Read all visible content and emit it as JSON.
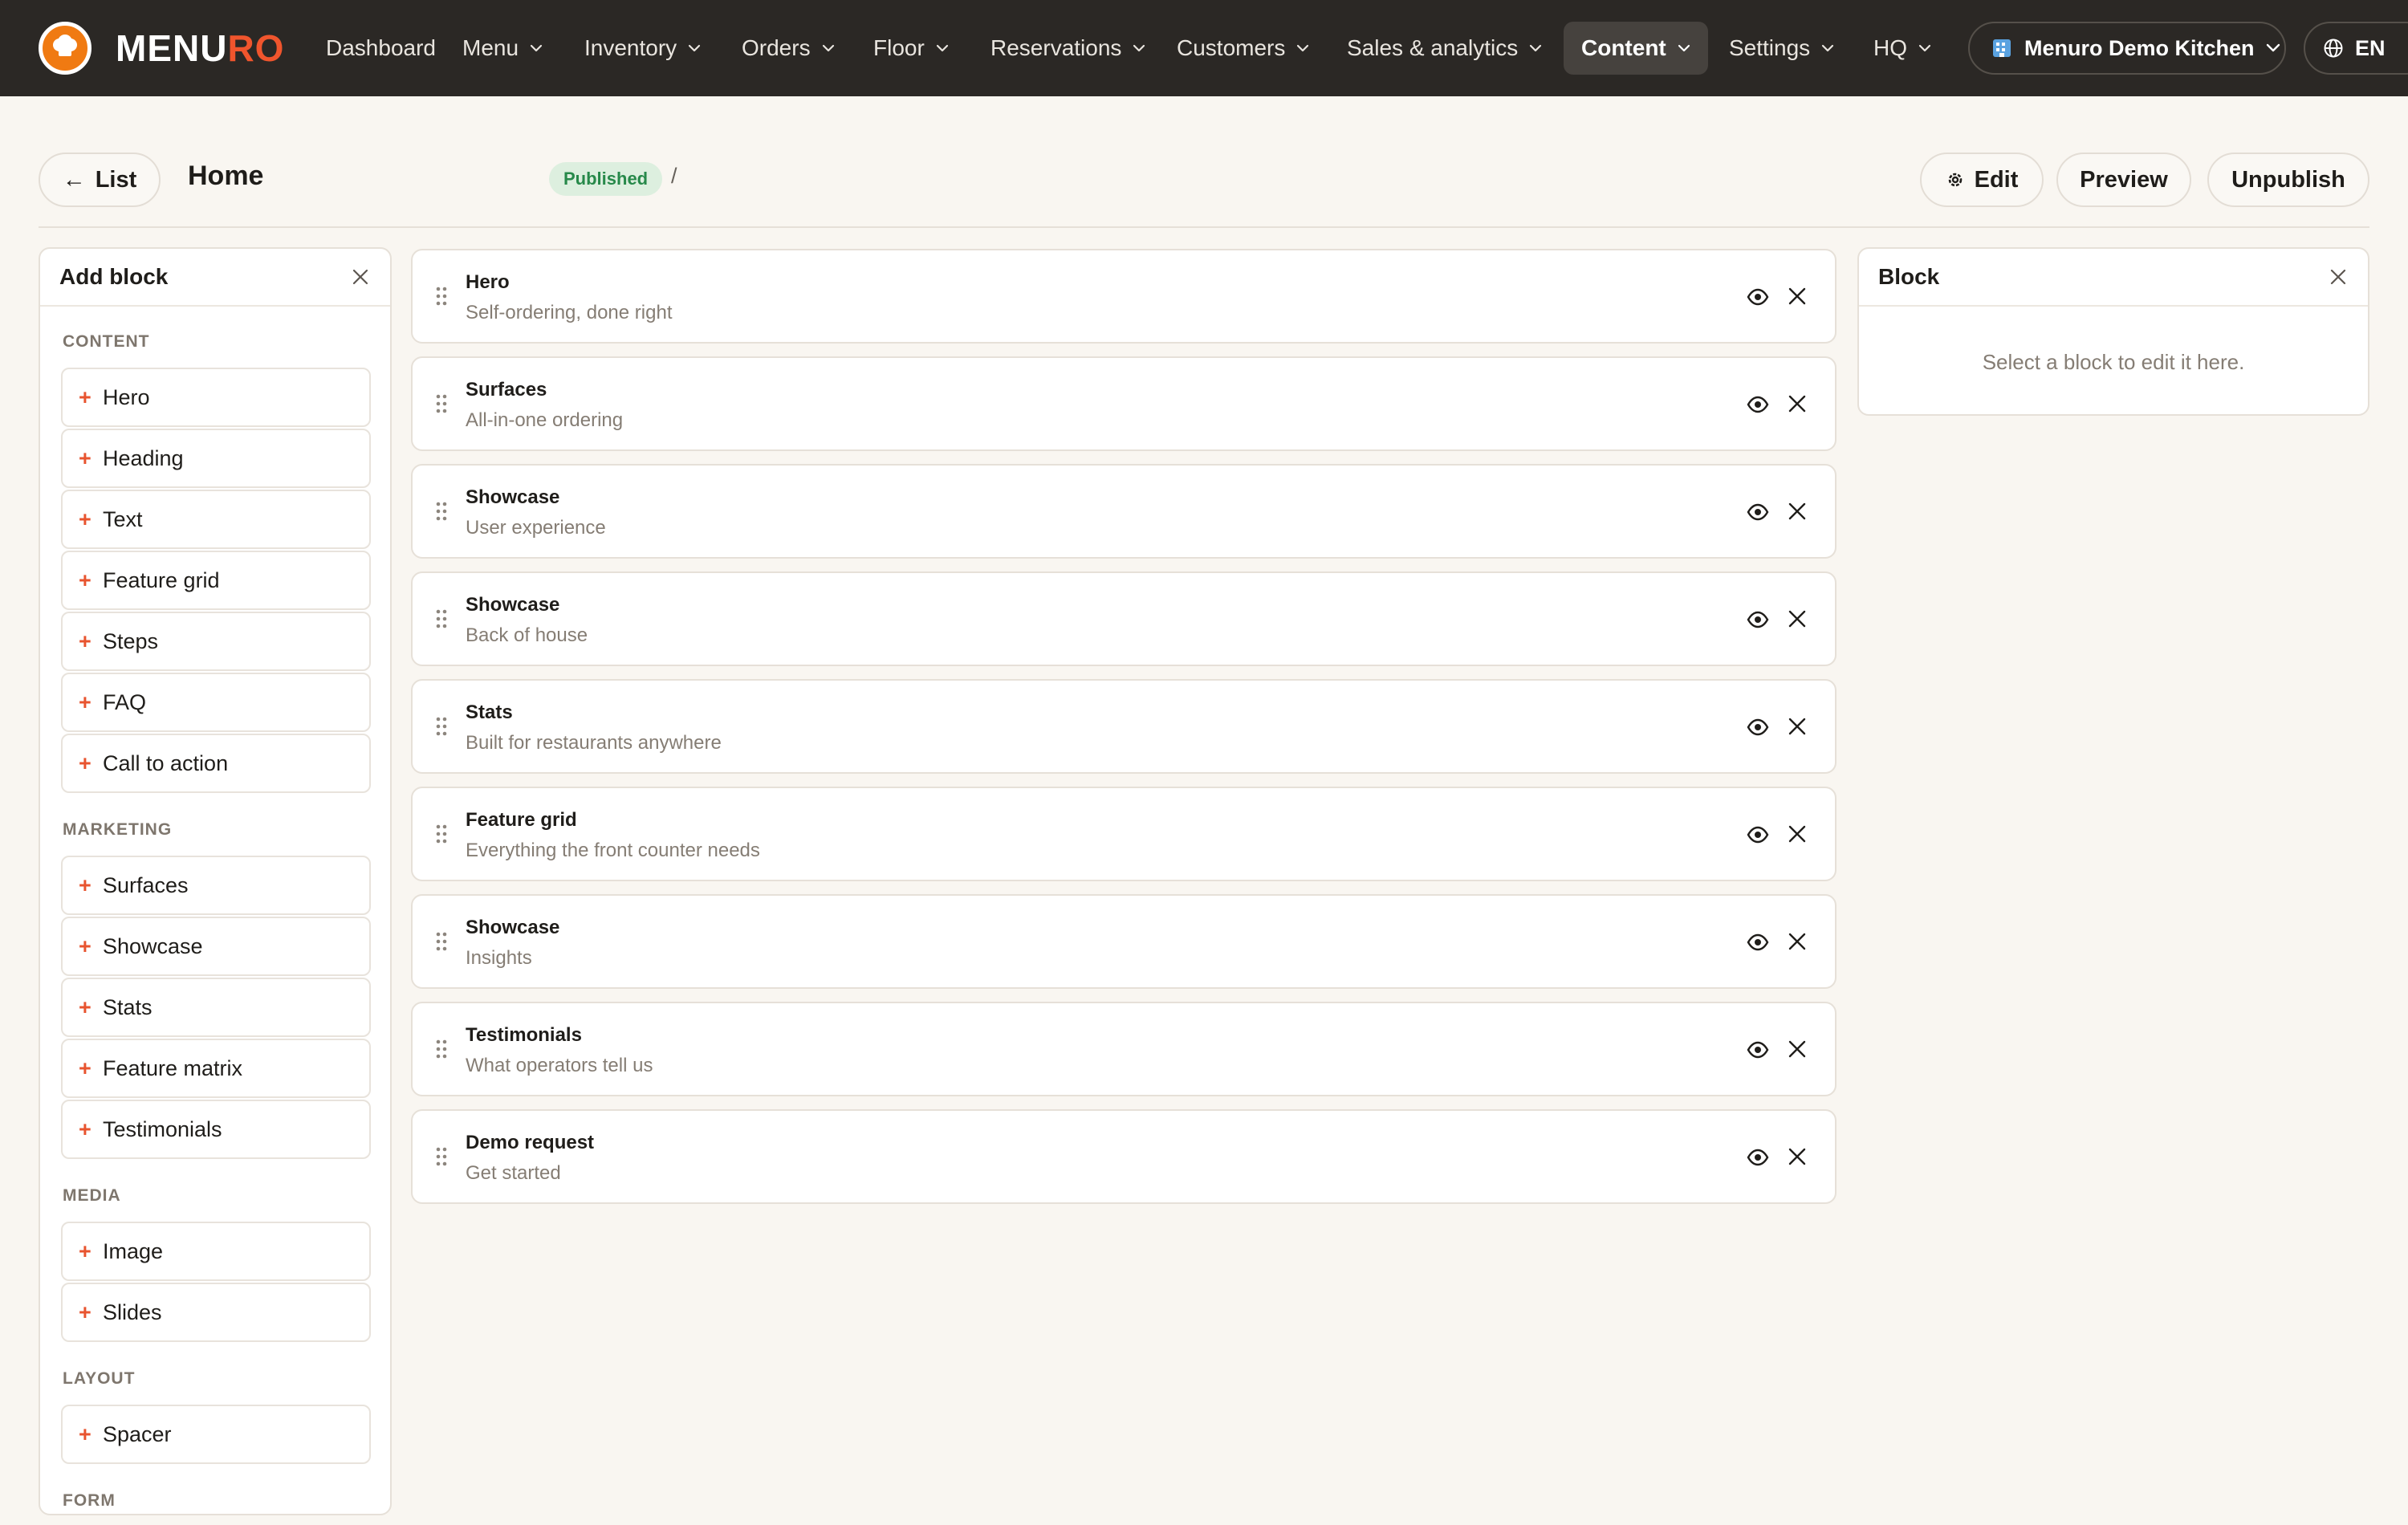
{
  "brand": {
    "name_part1": "MENU",
    "name_part2": "RO"
  },
  "nav": [
    {
      "label": "Dashboard",
      "has_menu": false
    },
    {
      "label": "Menu",
      "has_menu": true
    },
    {
      "label": "Inventory",
      "has_menu": true
    },
    {
      "label": "Orders",
      "has_menu": true
    },
    {
      "label": "Floor",
      "has_menu": true
    },
    {
      "label": "Reservations",
      "has_menu": true
    },
    {
      "label": "Customers",
      "has_menu": true
    },
    {
      "label": "Sales & analytics",
      "has_menu": true
    },
    {
      "label": "Content",
      "has_menu": true,
      "active": true
    },
    {
      "label": "Settings",
      "has_menu": true
    },
    {
      "label": "HQ",
      "has_menu": true
    }
  ],
  "location_selector": {
    "label": "Menuro Demo Kitchen",
    "icon": "building-icon"
  },
  "language_selector": {
    "label": "EN",
    "icon": "globe-icon"
  },
  "toolbar": {
    "back_label": "List",
    "page_title": "Home",
    "status": "Published",
    "breadcrumb_separator": "/",
    "edit_label": "Edit",
    "preview_label": "Preview",
    "unpublish_label": "Unpublish"
  },
  "add_block_panel": {
    "title": "Add block",
    "sections": [
      {
        "label": "CONTENT",
        "items": [
          "Hero",
          "Heading",
          "Text",
          "Feature grid",
          "Steps",
          "FAQ",
          "Call to action"
        ]
      },
      {
        "label": "MARKETING",
        "items": [
          "Surfaces",
          "Showcase",
          "Stats",
          "Feature matrix",
          "Testimonials"
        ]
      },
      {
        "label": "MEDIA",
        "items": [
          "Image",
          "Slides"
        ]
      },
      {
        "label": "LAYOUT",
        "items": [
          "Spacer"
        ]
      },
      {
        "label": "FORM",
        "items": []
      }
    ]
  },
  "blocks": [
    {
      "name": "Hero",
      "description": "Self-ordering, done right"
    },
    {
      "name": "Surfaces",
      "description": "All-in-one ordering"
    },
    {
      "name": "Showcase",
      "description": "User experience"
    },
    {
      "name": "Showcase",
      "description": "Back of house"
    },
    {
      "name": "Stats",
      "description": "Built for restaurants anywhere"
    },
    {
      "name": "Feature grid",
      "description": "Everything the front counter needs"
    },
    {
      "name": "Showcase",
      "description": "Insights"
    },
    {
      "name": "Testimonials",
      "description": "What operators tell us"
    },
    {
      "name": "Demo request",
      "description": "Get started"
    }
  ],
  "block_panel": {
    "title": "Block",
    "empty_text": "Select a block to edit it here."
  },
  "colors": {
    "nav_bg": "#2b2825",
    "page_bg": "#f9f6f1",
    "brand_orange": "#f07a12",
    "accent_red": "#e8542f",
    "published_green": "#27894a"
  }
}
